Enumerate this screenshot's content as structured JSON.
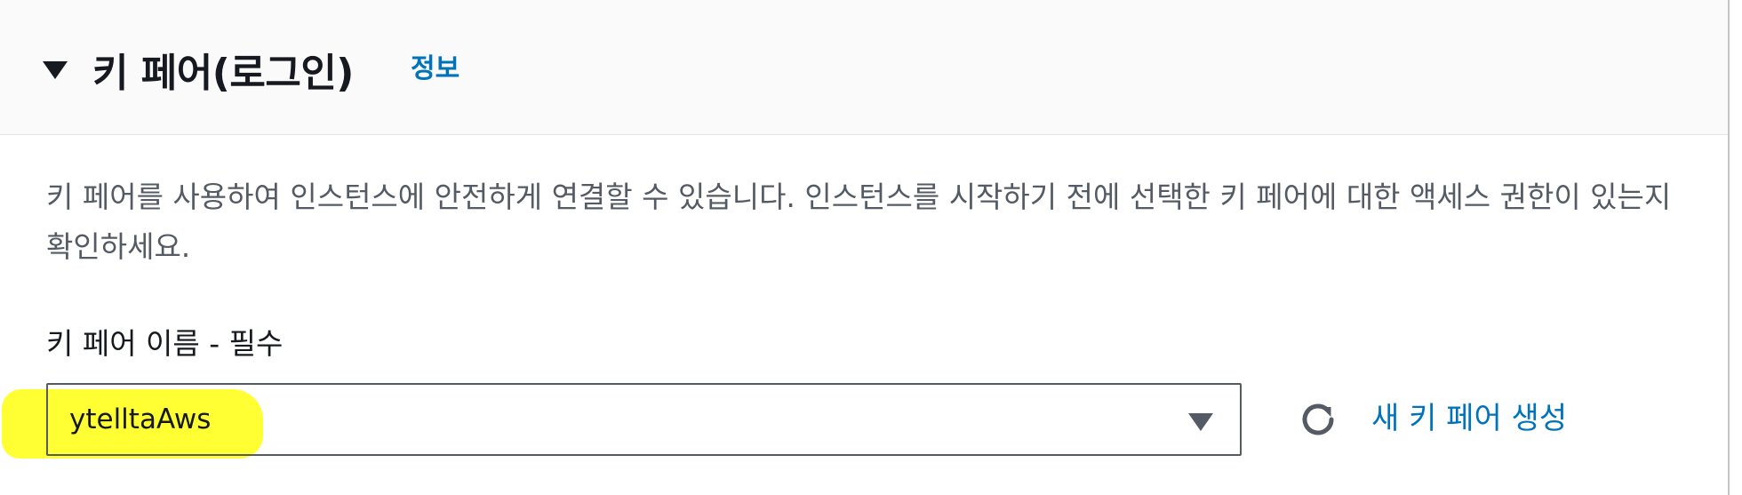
{
  "section": {
    "title": "키 페어(로그인)",
    "info_link": "정보",
    "description": "키 페어를 사용하여 인스턴스에 안전하게 연결할 수 있습니다. 인스턴스를 시작하기 전에 선택한 키 페어에 대한 액세스 권한이 있는지 확인하세요."
  },
  "key_pair_field": {
    "label": "키 페어 이름 - 필수",
    "selected_value": "ytelltaAws",
    "highlight_color": "#ffff33"
  },
  "actions": {
    "refresh_icon": "refresh-icon",
    "create_label": "새 키 페어 생성"
  },
  "colors": {
    "link": "#0073bb",
    "text": "#16191f",
    "secondary_text": "#545b64",
    "header_bg": "#fafafa"
  }
}
